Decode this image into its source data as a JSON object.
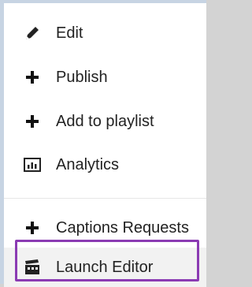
{
  "menu": {
    "items": [
      {
        "label": "Edit",
        "icon": "pencil-icon"
      },
      {
        "label": "Publish",
        "icon": "plus-icon"
      },
      {
        "label": "Add to playlist",
        "icon": "plus-icon"
      },
      {
        "label": "Analytics",
        "icon": "analytics-icon"
      },
      {
        "label": "Captions Requests",
        "icon": "plus-icon"
      },
      {
        "label": "Launch Editor",
        "icon": "clapperboard-icon",
        "highlighted": true
      }
    ]
  },
  "colors": {
    "highlight_border": "#8b3bb3",
    "text": "#222222",
    "hover_bg": "#f2f2f2"
  }
}
